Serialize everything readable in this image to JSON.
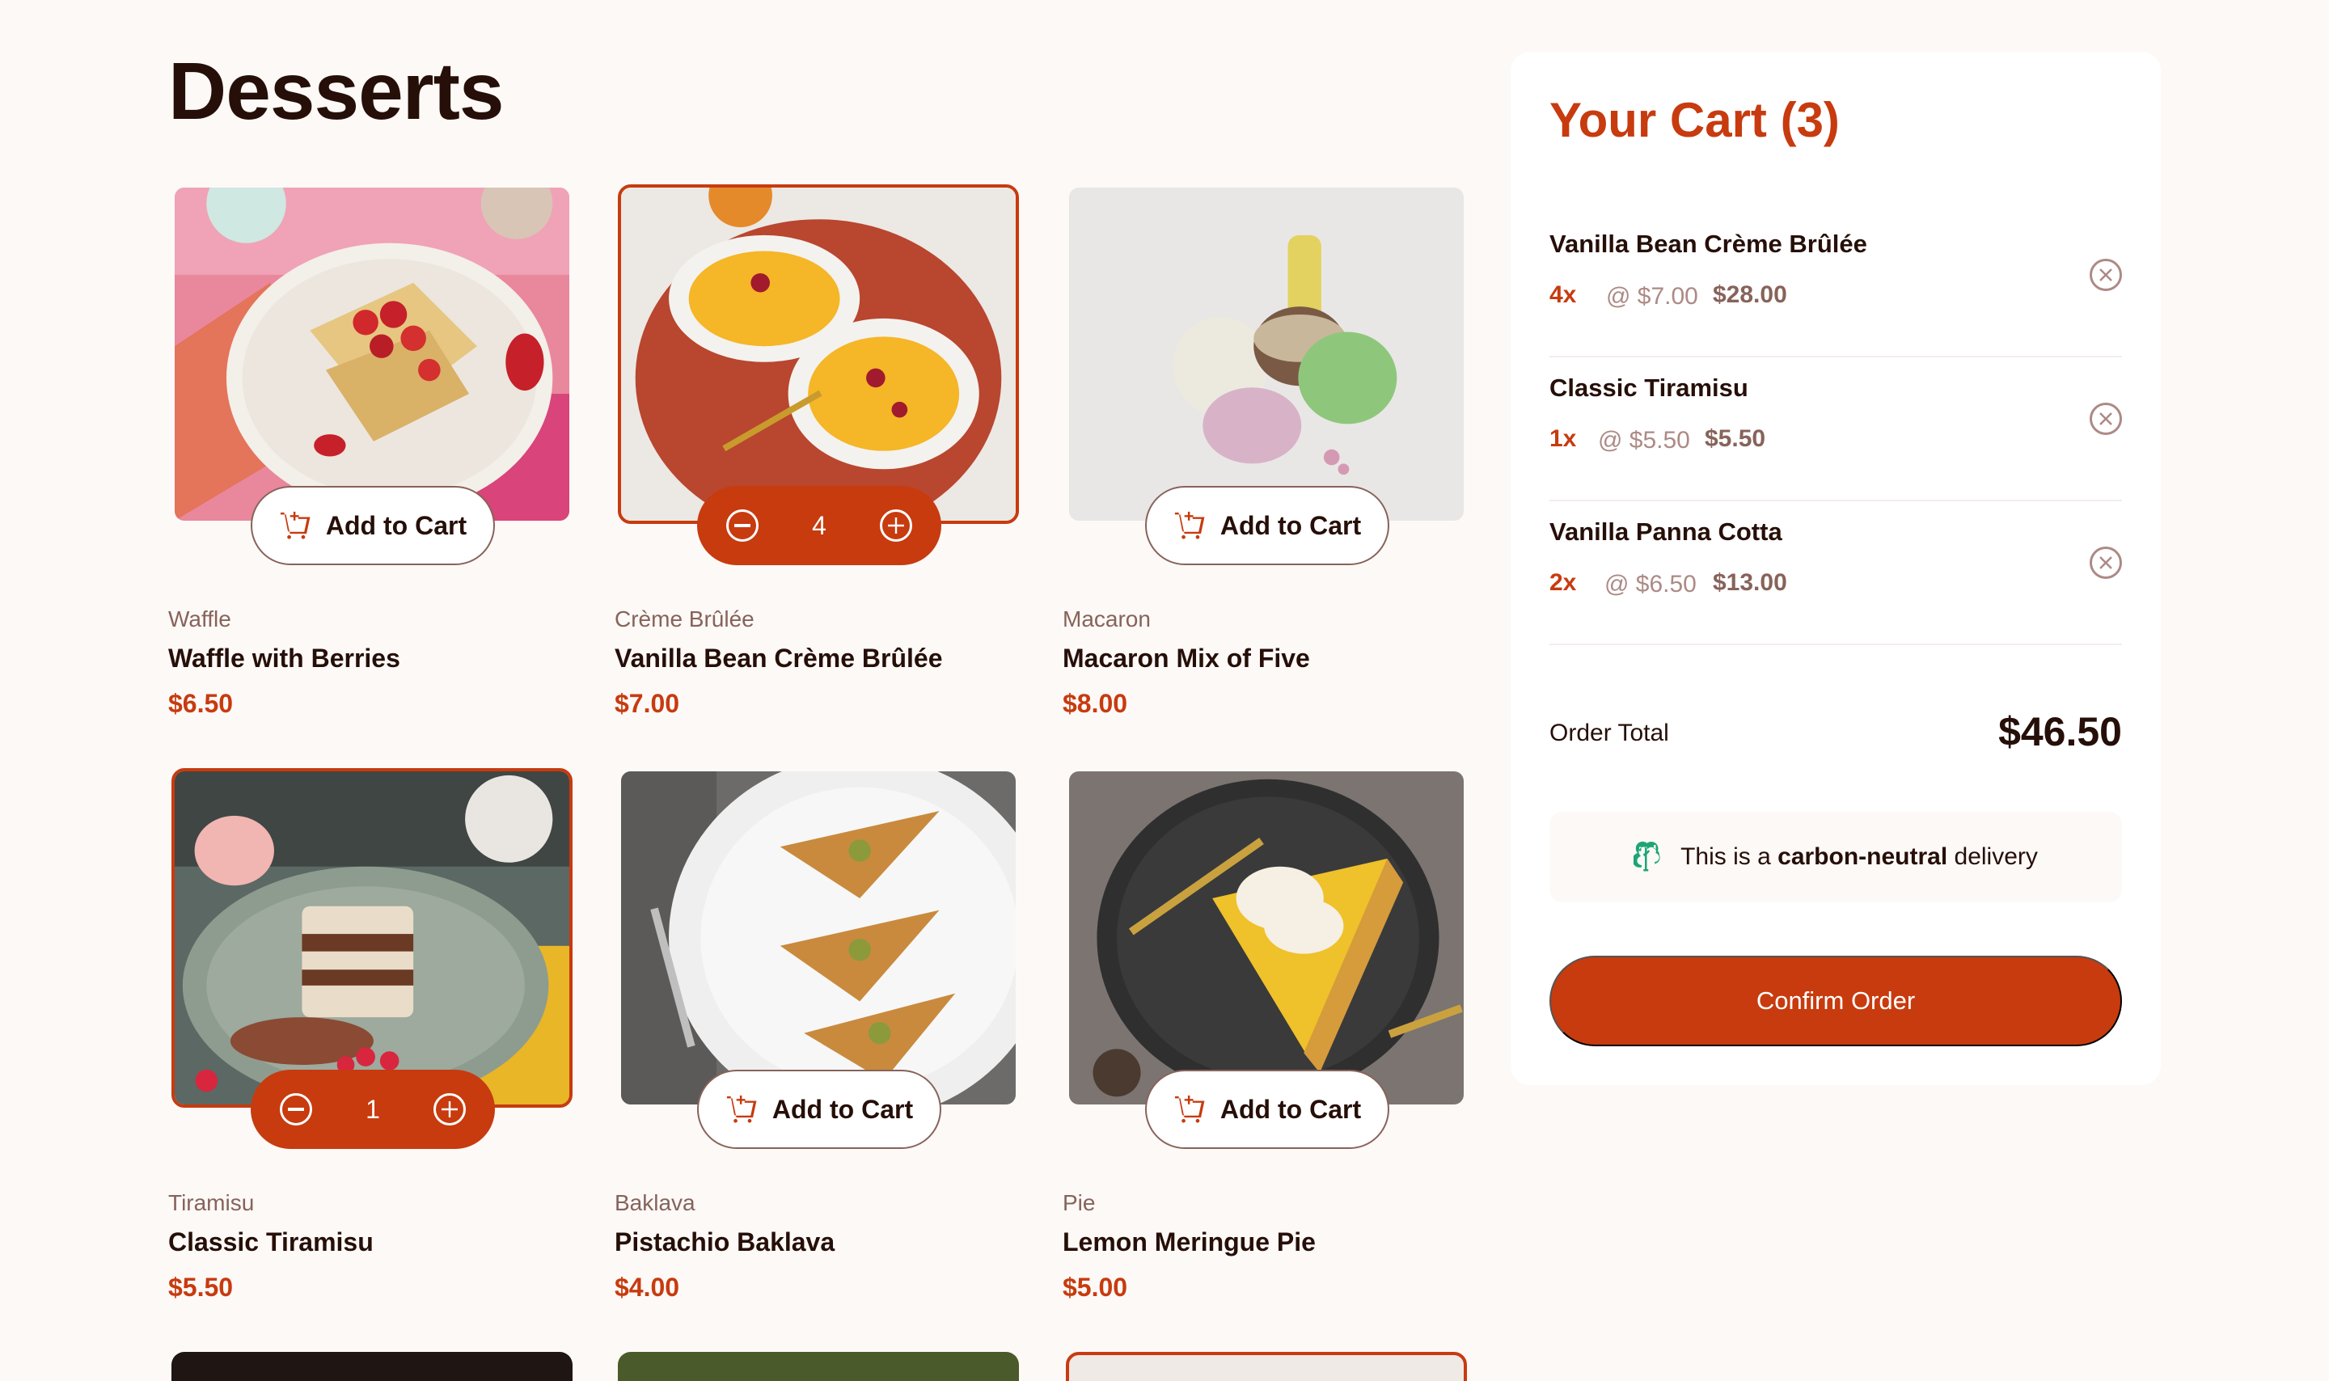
{
  "page_title": "Desserts",
  "colors": {
    "accent": "#c73b0f",
    "rose_900": "#260f08",
    "rose_500": "#87635a",
    "background": "#fcf9f7"
  },
  "add_to_cart_label": "Add to Cart",
  "products": [
    {
      "category": "Waffle",
      "name": "Waffle with Berries",
      "price": "$6.50",
      "in_cart": false,
      "image": "waffle-image"
    },
    {
      "category": "Crème Brûlée",
      "name": "Vanilla Bean Crème Brûlée",
      "price": "$7.00",
      "in_cart": true,
      "quantity": "4",
      "image": "creme-brulee-image"
    },
    {
      "category": "Macaron",
      "name": "Macaron Mix of Five",
      "price": "$8.00",
      "in_cart": false,
      "image": "macaron-image"
    },
    {
      "category": "Tiramisu",
      "name": "Classic Tiramisu",
      "price": "$5.50",
      "in_cart": true,
      "quantity": "1",
      "image": "tiramisu-image"
    },
    {
      "category": "Baklava",
      "name": "Pistachio Baklava",
      "price": "$4.00",
      "in_cart": false,
      "image": "baklava-image"
    },
    {
      "category": "Pie",
      "name": "Lemon Meringue Pie",
      "price": "$5.00",
      "in_cart": false,
      "image": "pie-image"
    }
  ],
  "cart": {
    "title": "Your Cart (3)",
    "items": [
      {
        "name": "Vanilla Bean Crème Brûlée",
        "qty": "4x",
        "unit": "@ $7.00",
        "total": "$28.00"
      },
      {
        "name": "Classic Tiramisu",
        "qty": "1x",
        "unit": "@ $5.50",
        "total": "$5.50"
      },
      {
        "name": "Vanilla Panna Cotta",
        "qty": "2x",
        "unit": "@ $6.50",
        "total": "$13.00"
      }
    ],
    "order_total_label": "Order Total",
    "order_total": "$46.50",
    "carbon_prefix": "This is a ",
    "carbon_bold": "carbon-neutral",
    "carbon_suffix": " delivery",
    "confirm_label": "Confirm Order"
  }
}
